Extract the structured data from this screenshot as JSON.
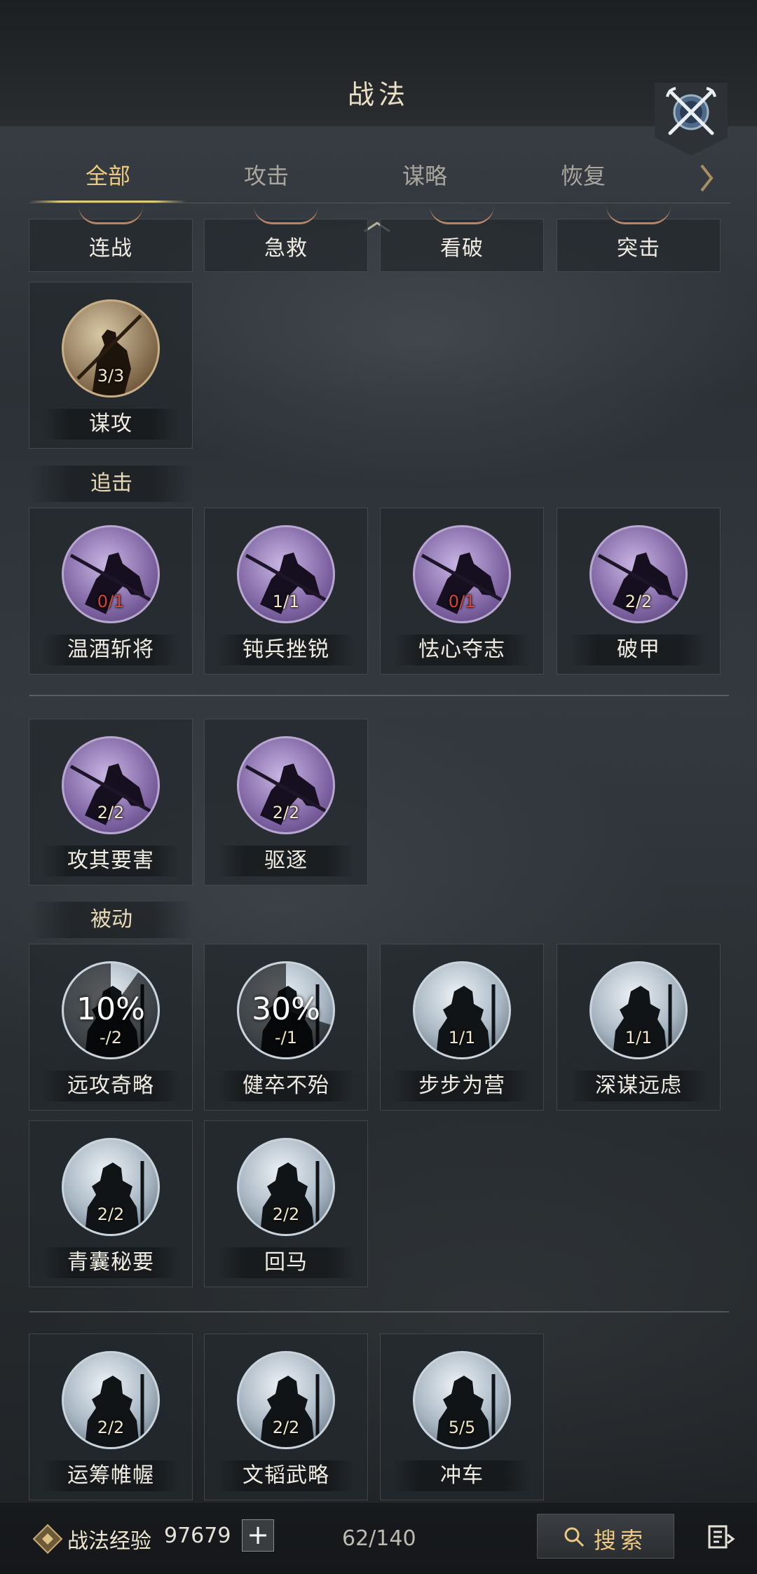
{
  "header": {
    "title": "战法"
  },
  "tabs": [
    {
      "label": "全部",
      "active": true
    },
    {
      "label": "攻击",
      "active": false
    },
    {
      "label": "谋略",
      "active": false
    },
    {
      "label": "恢复",
      "active": false
    }
  ],
  "top_row": [
    {
      "label": "连战"
    },
    {
      "label": "急救"
    },
    {
      "label": "看破"
    },
    {
      "label": "突击"
    }
  ],
  "strategy_cards": [
    {
      "label": "谋攻",
      "count": "3/3",
      "style": "brown"
    }
  ],
  "section_pursuit": {
    "title": "追击"
  },
  "pursuit_cards": [
    {
      "label": "温酒斩将",
      "count": "0/1",
      "red": true
    },
    {
      "label": "钝兵挫锐",
      "count": "1/1",
      "red": false
    },
    {
      "label": "怯心夺志",
      "count": "0/1",
      "red": true
    },
    {
      "label": "破甲",
      "count": "2/2",
      "red": false
    },
    {
      "label": "攻其要害",
      "count": "2/2",
      "red": false
    },
    {
      "label": "驱逐",
      "count": "2/2",
      "red": false
    }
  ],
  "section_passive": {
    "title": "被动"
  },
  "passive_cards": [
    {
      "label": "远攻奇略",
      "count": "-/2",
      "cooldown": "10%"
    },
    {
      "label": "健卒不殆",
      "count": "-/1",
      "cooldown": "30%"
    },
    {
      "label": "步步为营",
      "count": "1/1"
    },
    {
      "label": "深谋远虑",
      "count": "1/1"
    },
    {
      "label": "青囊秘要",
      "count": "2/2"
    },
    {
      "label": "回马",
      "count": "2/2"
    },
    {
      "label": "运筹帷幄",
      "count": "2/2"
    },
    {
      "label": "文韬武略",
      "count": "2/2"
    },
    {
      "label": "冲车",
      "count": "5/5"
    }
  ],
  "footer": {
    "exp_label": "战法经验",
    "exp_value": "97679",
    "plus": "+",
    "count": "62/140",
    "search_label": "搜索"
  },
  "colors": {
    "accent": "#ecc980",
    "count_red": "#d3473c"
  },
  "icons": [
    "close-crossed-swords-icon",
    "tab-next-chevron-icon",
    "exp-badge-icon",
    "search-icon",
    "list-menu-icon"
  ]
}
